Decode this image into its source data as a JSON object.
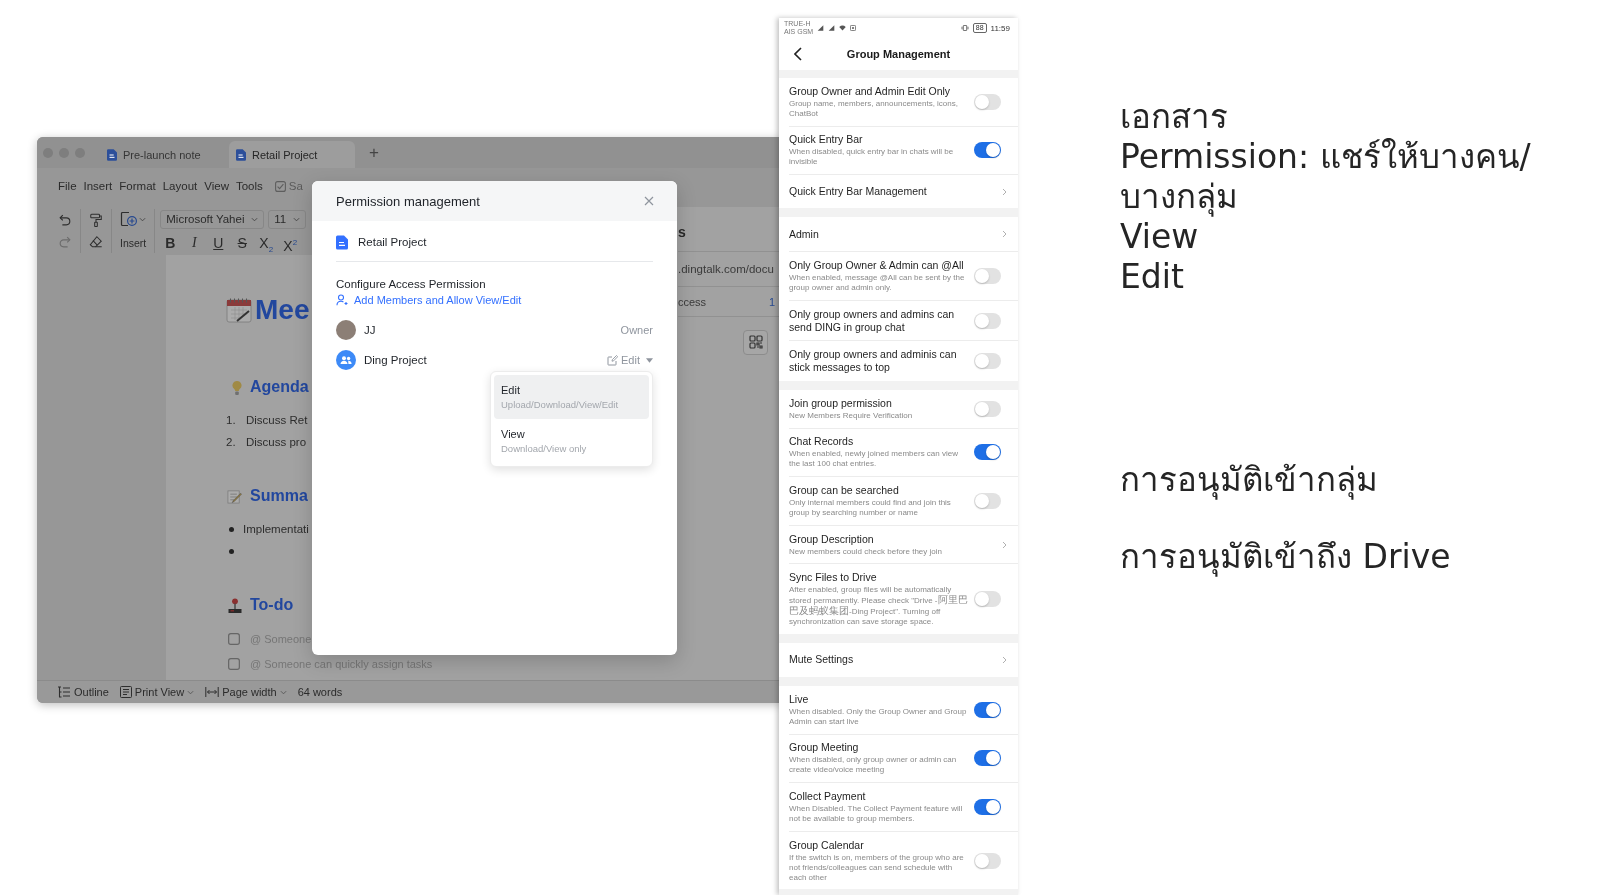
{
  "editor_window": {
    "tabs": [
      {
        "label": "Pre-launch note",
        "selected": false
      },
      {
        "label": "Retail Project",
        "selected": true
      }
    ],
    "new_tab": "+",
    "menu": [
      "File",
      "Insert",
      "Format",
      "Layout",
      "View",
      "Tools"
    ],
    "menu_checkbox": {
      "label": "Sa",
      "checked": true
    },
    "toolbar": {
      "insert": "Insert",
      "font": "Microsoft Yahei",
      "font_size": "11",
      "format_buttons": [
        {
          "kind": "bold",
          "label": "B"
        },
        {
          "kind": "italic",
          "label": "I"
        },
        {
          "kind": "underline",
          "label": "U"
        },
        {
          "kind": "strike",
          "label": "S"
        },
        {
          "kind": "subscript",
          "label": "X$_{2}$"
        },
        {
          "kind": "superscript",
          "label": "X$^{2}$"
        }
      ]
    },
    "document": {
      "blocks": [
        {
          "kind": "title",
          "text": "Mee"
        },
        {
          "kind": "heading",
          "text": "Agenda"
        },
        {
          "kind": "numbered",
          "number": "1.",
          "text": "Discuss Ret"
        },
        {
          "kind": "numbered",
          "number": "2.",
          "text": "Discuss pro"
        },
        {
          "kind": "heading",
          "text": "Summa"
        },
        {
          "kind": "bullet",
          "text": "Implementati"
        },
        {
          "kind": "bullet"
        },
        {
          "kind": "heading",
          "text": "To-do"
        },
        {
          "kind": "todo",
          "checked": false,
          "text": "@ Someone"
        },
        {
          "kind": "todo",
          "checked": false,
          "text": "@ Someone can quickly assign tasks"
        }
      ]
    },
    "share_panel": {
      "title": "s",
      "link": ".dingtalk.com/docu",
      "access_label": "ccess",
      "access_value": "1"
    },
    "status_bar": {
      "outline": "Outline",
      "view": "Print View",
      "width": "Page width",
      "word_count": "64 words"
    }
  },
  "permission_dialog": {
    "title": "Permission management",
    "document": "Retail Project",
    "section_title": "Configure Access Permission",
    "add_link": "Add Members and Allow View/Edit",
    "members": [
      {
        "kind": "person",
        "name": "JJ",
        "role": "Owner"
      },
      {
        "kind": "group",
        "name": "Ding Project",
        "role": "Edit"
      }
    ],
    "role_menu": {
      "options": [
        {
          "label": "Edit",
          "description": "Upload/Download/View/Edit",
          "selected": true
        },
        {
          "label": "View",
          "description": "Download/View only",
          "selected": false
        }
      ]
    }
  },
  "phone": {
    "status_bar": {
      "carriers": [
        "TRUE-H",
        "AIS GSM"
      ],
      "battery": "88",
      "time": "11:59"
    },
    "title": "Group Management",
    "sections": [
      {
        "rows": [
          {
            "kind": "toggle",
            "title": "Group Owner and Admin Edit Only",
            "description": "Group name, members, announcements, icons, ChatBot",
            "on": false
          },
          {
            "kind": "toggle",
            "title": "Quick Entry Bar",
            "description": "When disabled, quick entry bar in chats will be invisible",
            "on": true
          },
          {
            "kind": "link",
            "title": "Quick Entry Bar Management"
          }
        ]
      },
      {
        "rows": [
          {
            "kind": "link",
            "title": "Admin"
          },
          {
            "kind": "toggle",
            "title": "Only Group Owner & Admin can @All",
            "description": "When enabled, message @All can be sent by the group owner and admin only.",
            "on": false
          },
          {
            "kind": "toggle",
            "title": "Only group owners and admins can send DING in group chat",
            "on": false
          },
          {
            "kind": "toggle",
            "title": "Only group owners and adminis can stick messages to top",
            "on": false
          }
        ]
      },
      {
        "rows": [
          {
            "kind": "toggle",
            "title": "Join group permission",
            "description": "New Members Require Verification",
            "on": false
          },
          {
            "kind": "toggle",
            "title": "Chat Records",
            "description": "When enabled, newly joined members can view the last 100 chat entries.",
            "on": true
          },
          {
            "kind": "toggle",
            "title": "Group can be searched",
            "description": "Only internal members could find and join this group by searching number or name",
            "on": false
          },
          {
            "kind": "link",
            "title": "Group Description",
            "description": "New members could check before they join"
          },
          {
            "kind": "toggle",
            "title": "Sync Files to Drive",
            "description": "After enabled, group files will be automatically stored permanently. Please check \"Drive -阿里巴巴及蚂蚁集团-Ding Project\". Turning off synchronization can save storage space.",
            "on": false
          }
        ]
      },
      {
        "rows": [
          {
            "kind": "link",
            "title": "Mute Settings"
          }
        ]
      },
      {
        "rows": [
          {
            "kind": "toggle",
            "title": "Live",
            "description": "When disabled. Only the Group Owner and Group Admin can start live",
            "on": true
          },
          {
            "kind": "toggle",
            "title": "Group Meeting",
            "description": "When disabled, only group owner or admin can create video/voice meeting",
            "on": true
          },
          {
            "kind": "toggle",
            "title": "Collect Payment",
            "description": "When Disabled. The Collect Payment feature will not be available to group members.",
            "on": true
          },
          {
            "kind": "toggle",
            "title": "Group Calendar",
            "description": "If the switch is on, members of the group who are not friends/colleagues can send schedule with each other",
            "on": false
          }
        ]
      }
    ]
  },
  "notes": [
    {
      "lines": [
        "เอกสาร",
        "Permission: แชร์ให้บางคน/",
        "บางกลุ่ม",
        "View",
        "Edit"
      ]
    },
    {
      "lines": [
        "การอนุมัติเข้ากลุ่ม"
      ]
    },
    {
      "lines": [
        "การอนุมัติเข้าถึง Drive"
      ]
    }
  ]
}
